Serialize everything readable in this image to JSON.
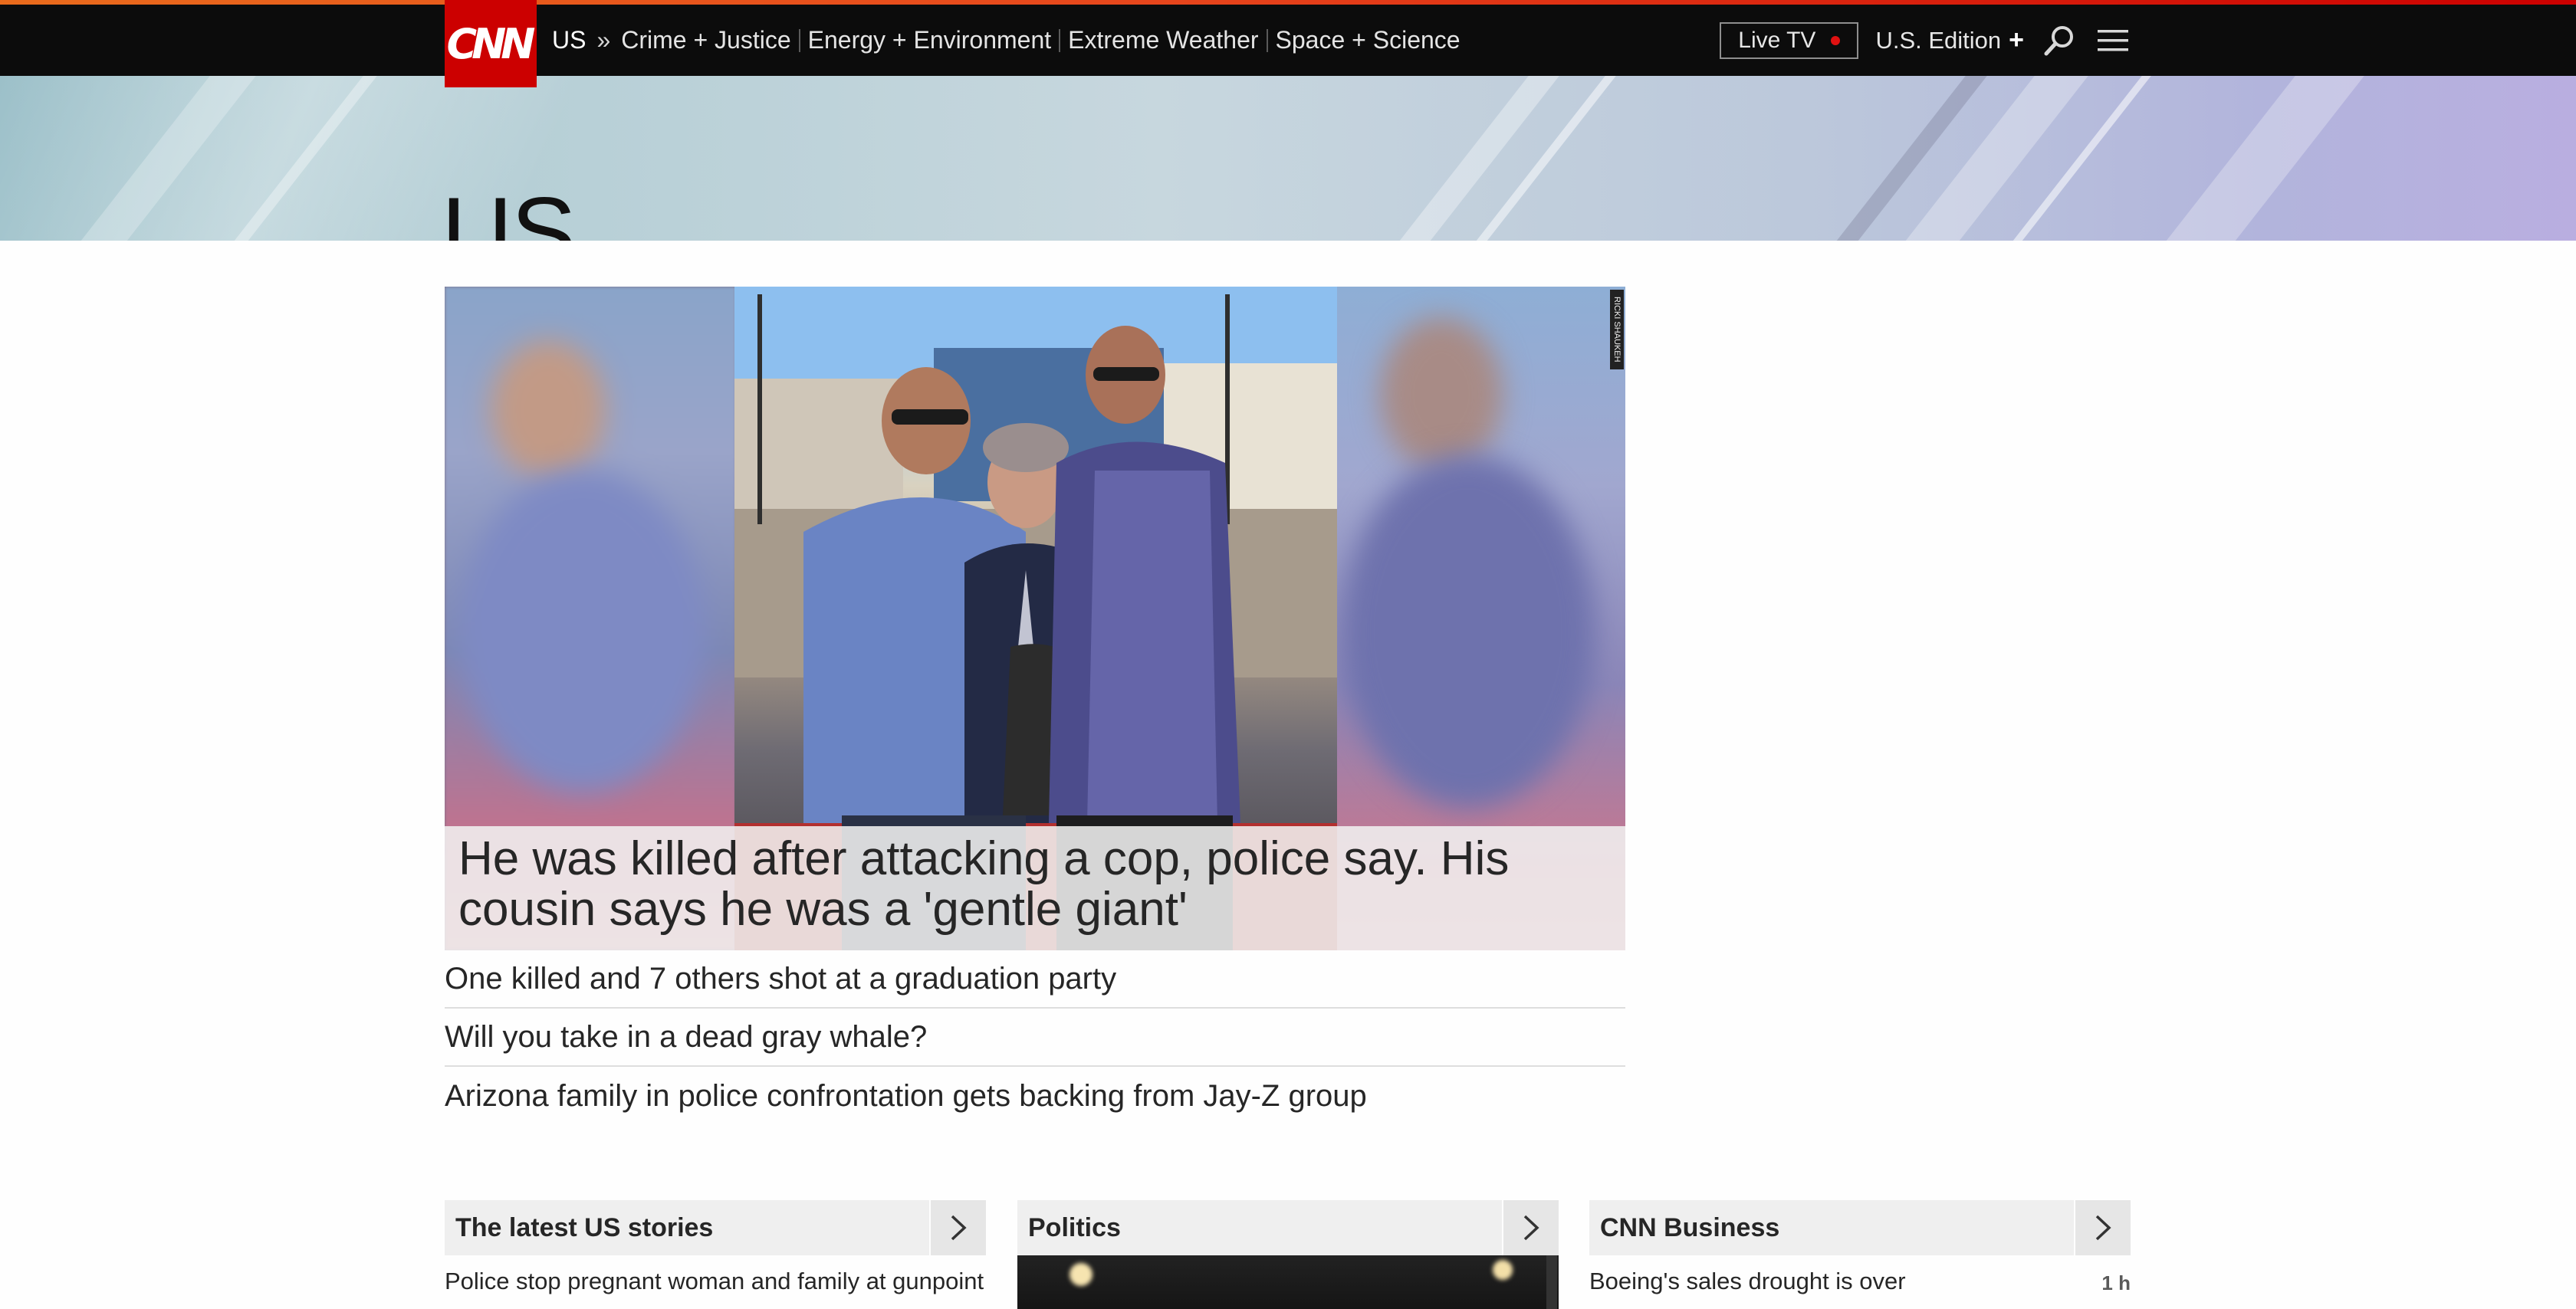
{
  "nav": {
    "logo": "CNN",
    "section": "US",
    "separator": "»",
    "links": [
      "Crime + Justice",
      "Energy + Environment",
      "Extreme Weather",
      "Space + Science"
    ],
    "live_tv": "Live TV",
    "edition": "U.S. Edition",
    "edition_plus": "+",
    "icons": [
      "search-icon",
      "hamburger-menu-icon"
    ]
  },
  "banner": {
    "title": "US"
  },
  "hero": {
    "headline": "He was killed after attacking a cop, police say. His cousin says he was a 'gentle giant'",
    "photo_credit": "RICKI SHAUKEH"
  },
  "related": [
    "One killed and 7 others shot at a graduation party",
    "Will you take in a dead gray whale?",
    "Arizona family in police confrontation gets backing from Jay-Z group"
  ],
  "columns": [
    {
      "title": "The latest US stories",
      "story": "Police stop pregnant woman and family at gunpoint",
      "meta": ""
    },
    {
      "title": "Politics",
      "story": "",
      "meta": ""
    },
    {
      "title": "CNN Business",
      "story": "Boeing's sales drought is over",
      "meta": "1 h"
    }
  ],
  "colors": {
    "brand_red": "#cc0000",
    "nav_bg": "#0c0c0c",
    "accent_orange": "#e96b1c",
    "live_dot": "#e01111"
  }
}
